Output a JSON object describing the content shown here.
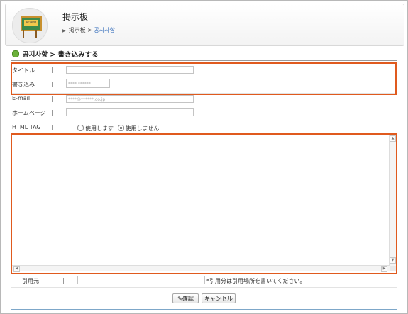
{
  "header": {
    "title": "掲示板",
    "breadcrumb": {
      "root": "掲示板",
      "separator": ">",
      "current": "공지사항"
    }
  },
  "section_title": "공지사항 > 書き込みする",
  "form": {
    "title_label": "タイトル",
    "author_label": "書き込み",
    "author_value": "**** ******",
    "email_label": "E-mail",
    "email_value": "****@******.co.jp",
    "homepage_label": "ホームページ",
    "html_tag_label": "HTML TAG",
    "html_options": [
      "使用します",
      "使用しません"
    ],
    "html_selected": "使用しません",
    "source_label": "引用元",
    "source_note": "*引用分は引用場所を書いてください。"
  },
  "buttons": {
    "confirm": "確認",
    "cancel": "キャンセル"
  },
  "colors": {
    "highlight": "#e05a1e",
    "breadcrumb_current": "#2a66b8",
    "bullet": "#6bb03a"
  },
  "icons": {
    "logo": "chalkboard-icon",
    "bullet": "circle-bullet-icon",
    "confirm": "pencil-icon"
  }
}
